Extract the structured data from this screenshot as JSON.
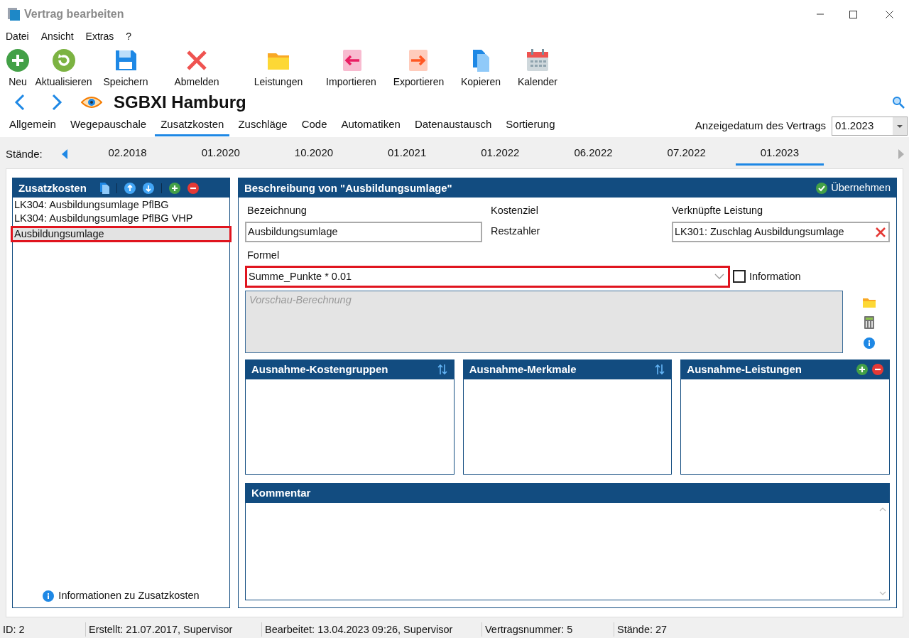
{
  "window": {
    "title": "Vertrag bearbeiten"
  },
  "menu": [
    "Datei",
    "Ansicht",
    "Extras",
    "?"
  ],
  "toolbar": [
    {
      "label": "Neu"
    },
    {
      "label": "Aktualisieren"
    },
    {
      "label": "Speichern"
    },
    {
      "label": "Abmelden"
    },
    {
      "label": "Leistungen"
    },
    {
      "label": "Importieren"
    },
    {
      "label": "Exportieren"
    },
    {
      "label": "Kopieren"
    },
    {
      "label": "Kalender"
    }
  ],
  "heading": "SGBXI Hamburg",
  "tabs": [
    {
      "label": "Allgemein",
      "selected": false
    },
    {
      "label": "Wegepauschale",
      "selected": false
    },
    {
      "label": "Zusatzkosten",
      "selected": true
    },
    {
      "label": "Zuschläge",
      "selected": false
    },
    {
      "label": "Code",
      "selected": false
    },
    {
      "label": "Automatiken",
      "selected": false
    },
    {
      "label": "Datenaustausch",
      "selected": false
    },
    {
      "label": "Sortierung",
      "selected": false
    }
  ],
  "display_date": {
    "label": "Anzeigedatum des Vertrags",
    "value": "01.2023"
  },
  "versions": {
    "label": "Stände:",
    "items": [
      {
        "label": "02.2018",
        "selected": false
      },
      {
        "label": "01.2020",
        "selected": false
      },
      {
        "label": "10.2020",
        "selected": false
      },
      {
        "label": "01.2021",
        "selected": false
      },
      {
        "label": "01.2022",
        "selected": false
      },
      {
        "label": "06.2022",
        "selected": false
      },
      {
        "label": "07.2022",
        "selected": false
      },
      {
        "label": "01.2023",
        "selected": true
      }
    ]
  },
  "cost_list": {
    "title": "Zusatzkosten",
    "items": [
      {
        "label": "LK304: Ausbildungsumlage PflBG",
        "selected": false,
        "highlighted": false
      },
      {
        "label": "LK304: Ausbildungsumlage PflBG VHP",
        "selected": false,
        "highlighted": false
      },
      {
        "label": "Ausbildungsumlage",
        "selected": true,
        "highlighted": true
      }
    ],
    "info_link": "Informationen zu Zusatzkosten"
  },
  "detail": {
    "title": "Beschreibung von \"Ausbildungsumlage\"",
    "apply_button": "Übernehmen",
    "name": {
      "label": "Bezeichnung",
      "value": "Ausbildungsumlage"
    },
    "cost_target": {
      "label": "Kostenziel",
      "value": "Restzahler"
    },
    "linked_service": {
      "label": "Verknüpfte Leistung",
      "value": "LK301: Zuschlag Ausbildungsumlage"
    },
    "formula": {
      "label": "Formel",
      "value": "Summe_Punkte * 0.01",
      "highlighted": true
    },
    "information": {
      "label": "Information",
      "checked": false
    },
    "preview": {
      "placeholder": "Vorschau-Berechnung"
    },
    "panels": [
      {
        "title": "Ausnahme-Kostengruppen",
        "kind": "sort"
      },
      {
        "title": "Ausnahme-Merkmale",
        "kind": "sort"
      },
      {
        "title": "Ausnahme-Leistungen",
        "kind": "addremove"
      }
    ],
    "comment": {
      "title": "Kommentar"
    }
  },
  "status_bar": [
    "ID: 2",
    "Erstellt: 21.07.2017, Supervisor",
    "Bearbeitet: 13.04.2023 09:26, Supervisor",
    "Vertragsnummer: 5",
    "Stände: 27"
  ]
}
